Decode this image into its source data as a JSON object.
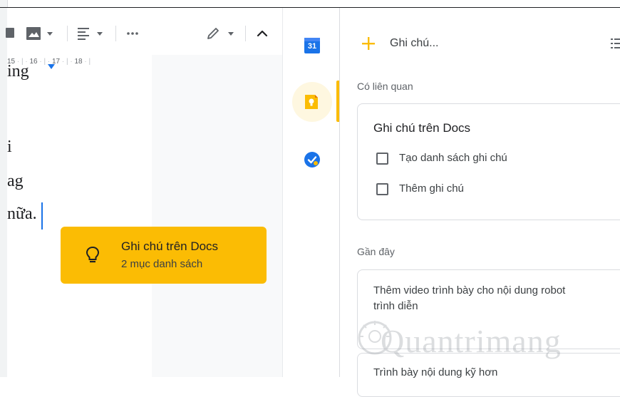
{
  "ruler": {
    "ticks": [
      "15",
      "16",
      "17",
      "18"
    ]
  },
  "document": {
    "lines": [
      "ing",
      "i",
      "ag",
      "nữa."
    ]
  },
  "tooltip": {
    "title": "Ghi chú trên Docs",
    "subtitle": "2 mục danh sách"
  },
  "rail": {
    "calendar_day": "31"
  },
  "keep": {
    "add_note_label": "Ghi chú...",
    "related_heading": "Có liên quan",
    "related_card": {
      "title": "Ghi chú trên Docs",
      "items": [
        "Tạo danh sách ghi chú",
        "Thêm ghi chú"
      ]
    },
    "recent_heading": "Gần đây",
    "recent_notes": [
      {
        "text": "Thêm video trình bày cho nội dung robot trình diễn"
      },
      {
        "text": "Trình bày nội dung kỹ hơn"
      }
    ]
  },
  "watermark": {
    "text": "Quantrimang"
  },
  "colors": {
    "accent_yellow": "#fbbc04",
    "calendar_blue": "#1a73e8",
    "tasks_blue": "#4285f4"
  }
}
